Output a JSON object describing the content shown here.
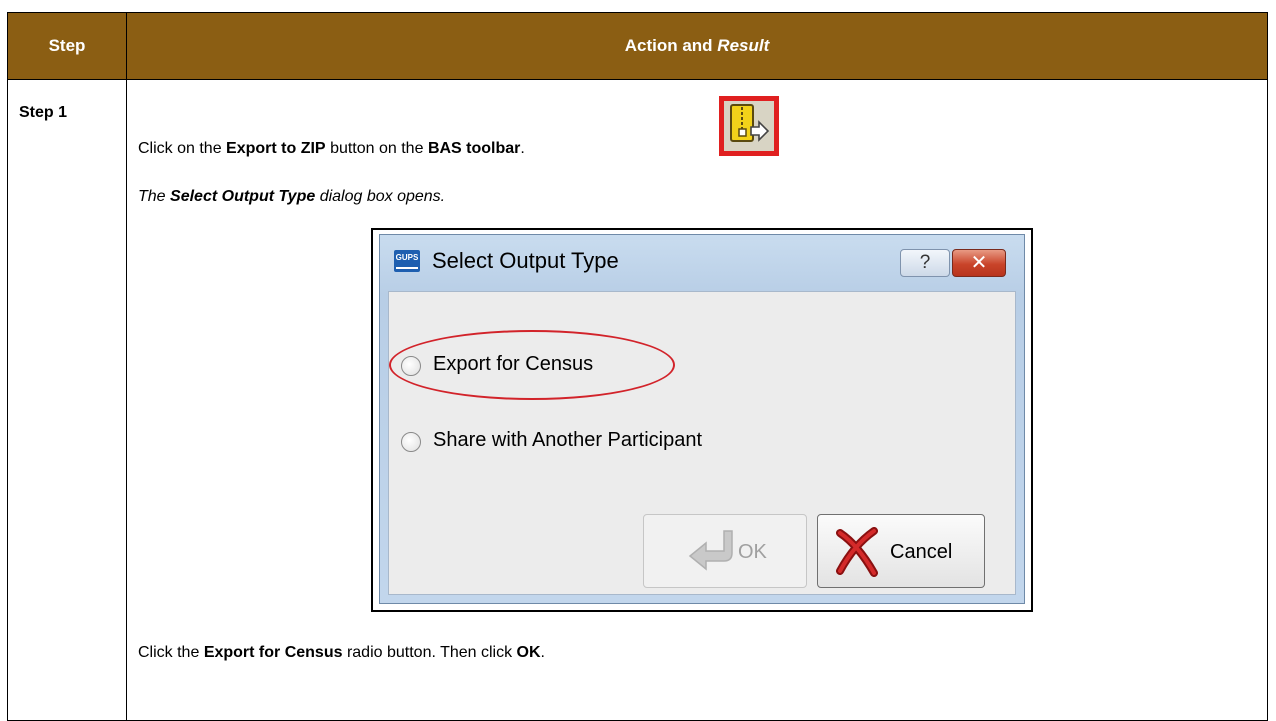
{
  "table": {
    "header": {
      "step": "Step",
      "action_plain": "Action and",
      "action_italic": "Result"
    },
    "rows": [
      {
        "step_label": "Step 1",
        "instruction_1": {
          "pre": "Click on the",
          "button": "Export to ZIP",
          "mid": "button on the",
          "toolbar": "BAS toolbar",
          "post": "."
        },
        "result": {
          "pre": "The",
          "dialog": "Select Output Type",
          "post": "dialog box opens."
        },
        "instruction_2": {
          "pre": "Click the",
          "option": "Export for Census",
          "mid": "radio button. Then click",
          "ok": "OK",
          "post": "."
        }
      }
    ]
  },
  "dialog": {
    "app_icon_text": "GUPS",
    "title": "Select Output Type",
    "help_label": "?",
    "close_label": "✕",
    "options": [
      {
        "label": "Export for Census",
        "selected": false,
        "highlighted": true
      },
      {
        "label": "Share with Another Participant",
        "selected": false
      }
    ],
    "ok_label": "OK",
    "ok_enabled": false,
    "cancel_label": "Cancel"
  },
  "colors": {
    "header_bg": "#8b5e13",
    "highlight": "#e02020"
  }
}
